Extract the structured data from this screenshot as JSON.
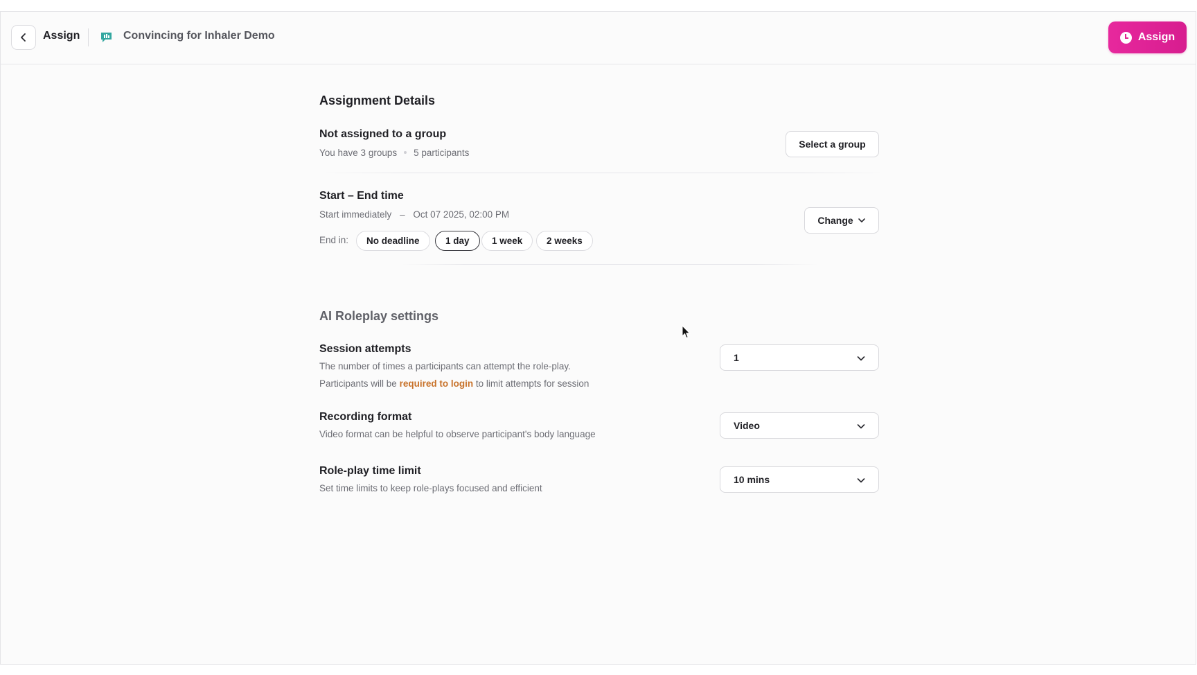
{
  "header": {
    "back_icon": "chevron-left-icon",
    "breadcrumb_label": "Assign",
    "scenario_icon": "chat-bubble-icon",
    "scenario_title": "Convincing for Inhaler Demo",
    "primary_action_label": "Assign",
    "primary_action_icon": "clock-icon",
    "accent_color": "#e0238f"
  },
  "assignment": {
    "section_title": "Assignment Details",
    "group": {
      "title": "Not assigned to a group",
      "groups_count_text": "You have 3 groups",
      "participants_text": "5 participants",
      "button_label": "Select a group"
    },
    "time": {
      "title": "Start – End time",
      "start_text": "Start immediately",
      "range_sep": "–",
      "end_text": "Oct 07 2025, 02:00 PM",
      "button_label": "Change",
      "end_in_label": "End in:",
      "end_options": [
        "No deadline",
        "1 day",
        "1 week",
        "2 weeks"
      ],
      "selected_option": "1 day"
    }
  },
  "roleplay": {
    "section_title": "AI Roleplay settings",
    "session_attempts": {
      "title": "Session attempts",
      "desc_line1": "The number of times a participants can attempt the role-play.",
      "desc_line2_prefix": "Participants will be ",
      "desc_line2_link": "required to login",
      "desc_line2_suffix": " to limit attempts for session",
      "selected_value": "1",
      "link_color": "#c8722a"
    },
    "recording_format": {
      "title": "Recording format",
      "desc": "Video format can be helpful to observe participant's body language",
      "selected_value": "Video"
    },
    "time_limit": {
      "title": "Role-play time limit",
      "desc": "Set time limits to keep role-plays focused and efficient",
      "selected_value": "10 mins"
    }
  }
}
